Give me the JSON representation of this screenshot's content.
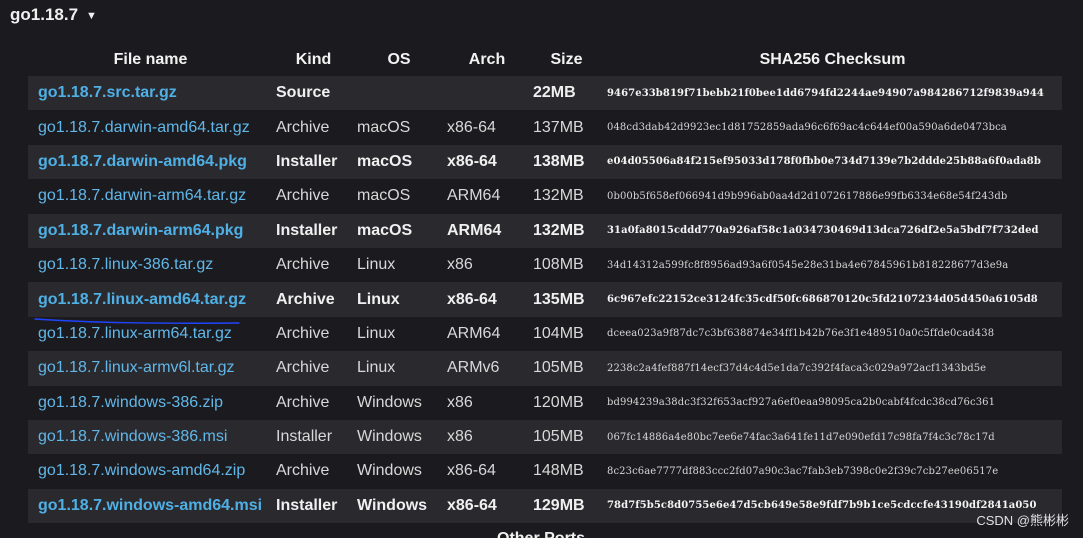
{
  "release": {
    "version": "go1.18.7",
    "caret": "▼"
  },
  "table": {
    "headers": {
      "file_name": "File name",
      "kind": "Kind",
      "os": "OS",
      "arch": "Arch",
      "size": "Size",
      "checksum": "SHA256 Checksum"
    },
    "rows": [
      {
        "file": "go1.18.7.src.tar.gz",
        "kind": "Source",
        "os": "",
        "arch": "",
        "size": "22MB",
        "checksum": "9467e33b819f71bebb21f0bee1dd6794fd2244ae94907a984286712f9839a944"
      },
      {
        "file": "go1.18.7.darwin-amd64.tar.gz",
        "kind": "Archive",
        "os": "macOS",
        "arch": "x86-64",
        "size": "137MB",
        "checksum": "048cd3dab42d9923ec1d81752859ada96c6f69ac4c644ef00a590a6de0473bca"
      },
      {
        "file": "go1.18.7.darwin-amd64.pkg",
        "kind": "Installer",
        "os": "macOS",
        "arch": "x86-64",
        "size": "138MB",
        "checksum": "e04d05506a84f215ef95033d178f0fbb0e734d7139e7b2ddde25b88a6f0ada8b"
      },
      {
        "file": "go1.18.7.darwin-arm64.tar.gz",
        "kind": "Archive",
        "os": "macOS",
        "arch": "ARM64",
        "size": "132MB",
        "checksum": "0b00b5f658ef066941d9b996ab0aa4d2d1072617886e99fb6334e68e54f243db"
      },
      {
        "file": "go1.18.7.darwin-arm64.pkg",
        "kind": "Installer",
        "os": "macOS",
        "arch": "ARM64",
        "size": "132MB",
        "checksum": "31a0fa8015cddd770a926af58c1a034730469d13dca726df2e5a5bdf7f732ded"
      },
      {
        "file": "go1.18.7.linux-386.tar.gz",
        "kind": "Archive",
        "os": "Linux",
        "arch": "x86",
        "size": "108MB",
        "checksum": "34d14312a599fc8f8956ad93a6f0545e28e31ba4e67845961b818228677d3e9a"
      },
      {
        "file": "go1.18.7.linux-amd64.tar.gz",
        "kind": "Archive",
        "os": "Linux",
        "arch": "x86-64",
        "size": "135MB",
        "checksum": "6c967efc22152ce3124fc35cdf50fc686870120c5fd2107234d05d450a6105d8"
      },
      {
        "file": "go1.18.7.linux-arm64.tar.gz",
        "kind": "Archive",
        "os": "Linux",
        "arch": "ARM64",
        "size": "104MB",
        "checksum": "dceea023a9f87dc7c3bf638874e34ff1b42b76e3f1e489510a0c5ffde0cad438"
      },
      {
        "file": "go1.18.7.linux-armv6l.tar.gz",
        "kind": "Archive",
        "os": "Linux",
        "arch": "ARMv6",
        "size": "105MB",
        "checksum": "2238c2a4fef887f14ecf37d4c4d5e1da7c392f4faca3c029a972acf1343bd5e"
      },
      {
        "file": "go1.18.7.windows-386.zip",
        "kind": "Archive",
        "os": "Windows",
        "arch": "x86",
        "size": "120MB",
        "checksum": "bd994239a38dc3f32f653acf927a6ef0eaa98095ca2b0cabf4fcdc38cd76c361"
      },
      {
        "file": "go1.18.7.windows-386.msi",
        "kind": "Installer",
        "os": "Windows",
        "arch": "x86",
        "size": "105MB",
        "checksum": "067fc14886a4e80bc7ee6e74fac3a641fe11d7e090efd17c98fa7f4c3c78c17d"
      },
      {
        "file": "go1.18.7.windows-amd64.zip",
        "kind": "Archive",
        "os": "Windows",
        "arch": "x86-64",
        "size": "148MB",
        "checksum": "8c23c6ae7777df883ccc2fd07a90c3ac7fab3eb7398c0e2f39c7cb27ee06517e"
      },
      {
        "file": "go1.18.7.windows-amd64.msi",
        "kind": "Installer",
        "os": "Windows",
        "arch": "x86-64",
        "size": "129MB",
        "checksum": "78d7f5b5c8d0755e6e47d5cb649e58e9fdf7b9b1ce5cdccfe43190df2841a050"
      }
    ]
  },
  "footer": {
    "partial_text": "Other Ports"
  },
  "watermark": {
    "text": "CSDN @熊彬彬"
  },
  "colors": {
    "background": "#1b1b1f",
    "row_shade": "#2a2a2e",
    "link": "#61b7e9",
    "underline": "#1f44ff"
  }
}
